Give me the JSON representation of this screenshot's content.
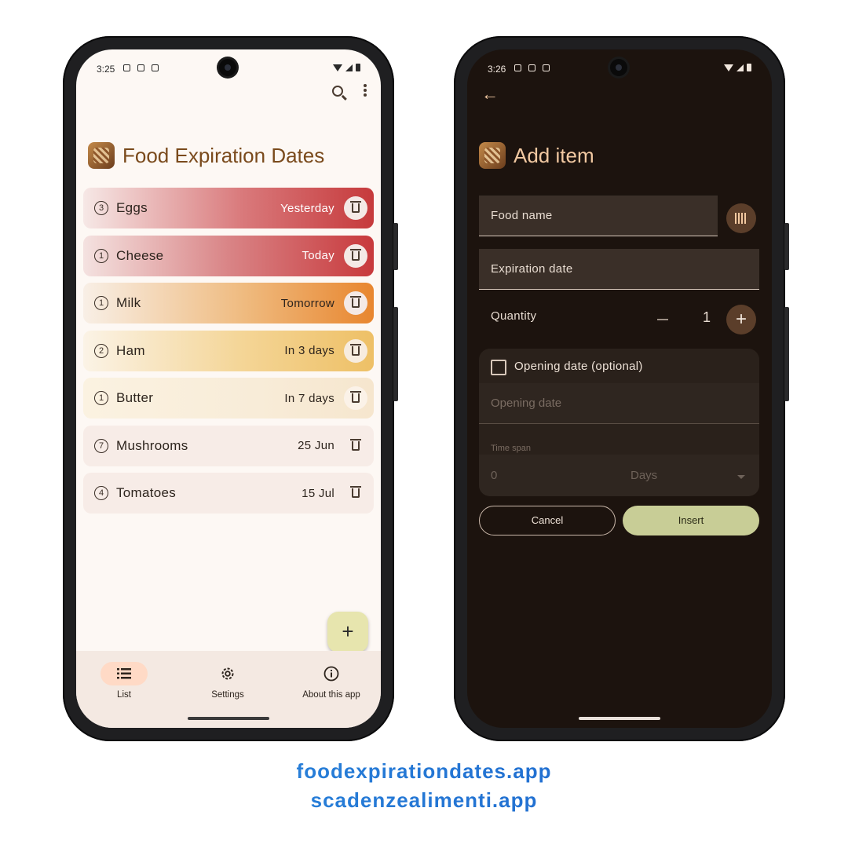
{
  "left": {
    "status_time": "3:25",
    "app_title": "Food Expiration Dates",
    "items": [
      {
        "count": "3",
        "name": "Eggs",
        "when": "Yesterday",
        "bg": "linear-gradient(90deg,#f6e8e6 0%,#d9797b 55%,#c63a3c 100%)",
        "color": "#ffffff",
        "trash_bg": "#f4e9e6"
      },
      {
        "count": "1",
        "name": "Cheese",
        "when": "Today",
        "bg": "linear-gradient(90deg,#f4e2e0 0%,#d98486 50%,#c8393c 100%)",
        "color": "#ffffff",
        "trash_bg": "#f4e9e6"
      },
      {
        "count": "1",
        "name": "Milk",
        "when": "Tomorrow",
        "bg": "linear-gradient(90deg,#f8efe6 0%,#efbb80 55%,#e8862f 100%)",
        "color": "#2d241d",
        "trash_bg": "#f4e9e6"
      },
      {
        "count": "2",
        "name": "Ham",
        "when": "In 3 days",
        "bg": "linear-gradient(90deg,#fbf3e6 0%,#f4d596 55%,#eec066 100%)",
        "color": "#2d241d",
        "trash_bg": "#f7ecdf"
      },
      {
        "count": "1",
        "name": "Butter",
        "when": "In 7 days",
        "bg": "linear-gradient(90deg,#fbf2e1 0%,#f8ecd8 60%,#f6e6ce 100%)",
        "color": "#2d241d",
        "trash_bg": "#fbf2e8"
      },
      {
        "count": "7",
        "name": "Mushrooms",
        "when": "25 Jun",
        "bg": "#f7ece7",
        "color": "#2d241d",
        "trash_bg": "transparent"
      },
      {
        "count": "4",
        "name": "Tomatoes",
        "when": "15 Jul",
        "bg": "#f7ece7",
        "color": "#2d241d",
        "trash_bg": "transparent"
      }
    ],
    "fab_label": "+",
    "nav": [
      {
        "label": "List",
        "icon": "list-icon"
      },
      {
        "label": "Settings",
        "icon": "gear-icon"
      },
      {
        "label": "About this app",
        "icon": "info-icon"
      }
    ]
  },
  "right": {
    "status_time": "3:26",
    "title": "Add item",
    "food_name_label": "Food name",
    "expiration_label": "Expiration date",
    "quantity_label": "Quantity",
    "quantity_value": "1",
    "opening_checkbox_label": "Opening date (optional)",
    "opening_date_placeholder": "Opening date",
    "time_span_label": "Time span",
    "time_span_value": "0",
    "time_span_unit": "Days",
    "cancel_label": "Cancel",
    "insert_label": "Insert"
  },
  "footer": {
    "url1": "foodexpirationdates.app",
    "url2": "scadenzealimenti.app"
  },
  "colors": {
    "accent_light": "#7a4a1c",
    "accent_dark": "#f2c9a2",
    "insert_button": "#c8cd96",
    "fab": "#e7e5ae"
  }
}
